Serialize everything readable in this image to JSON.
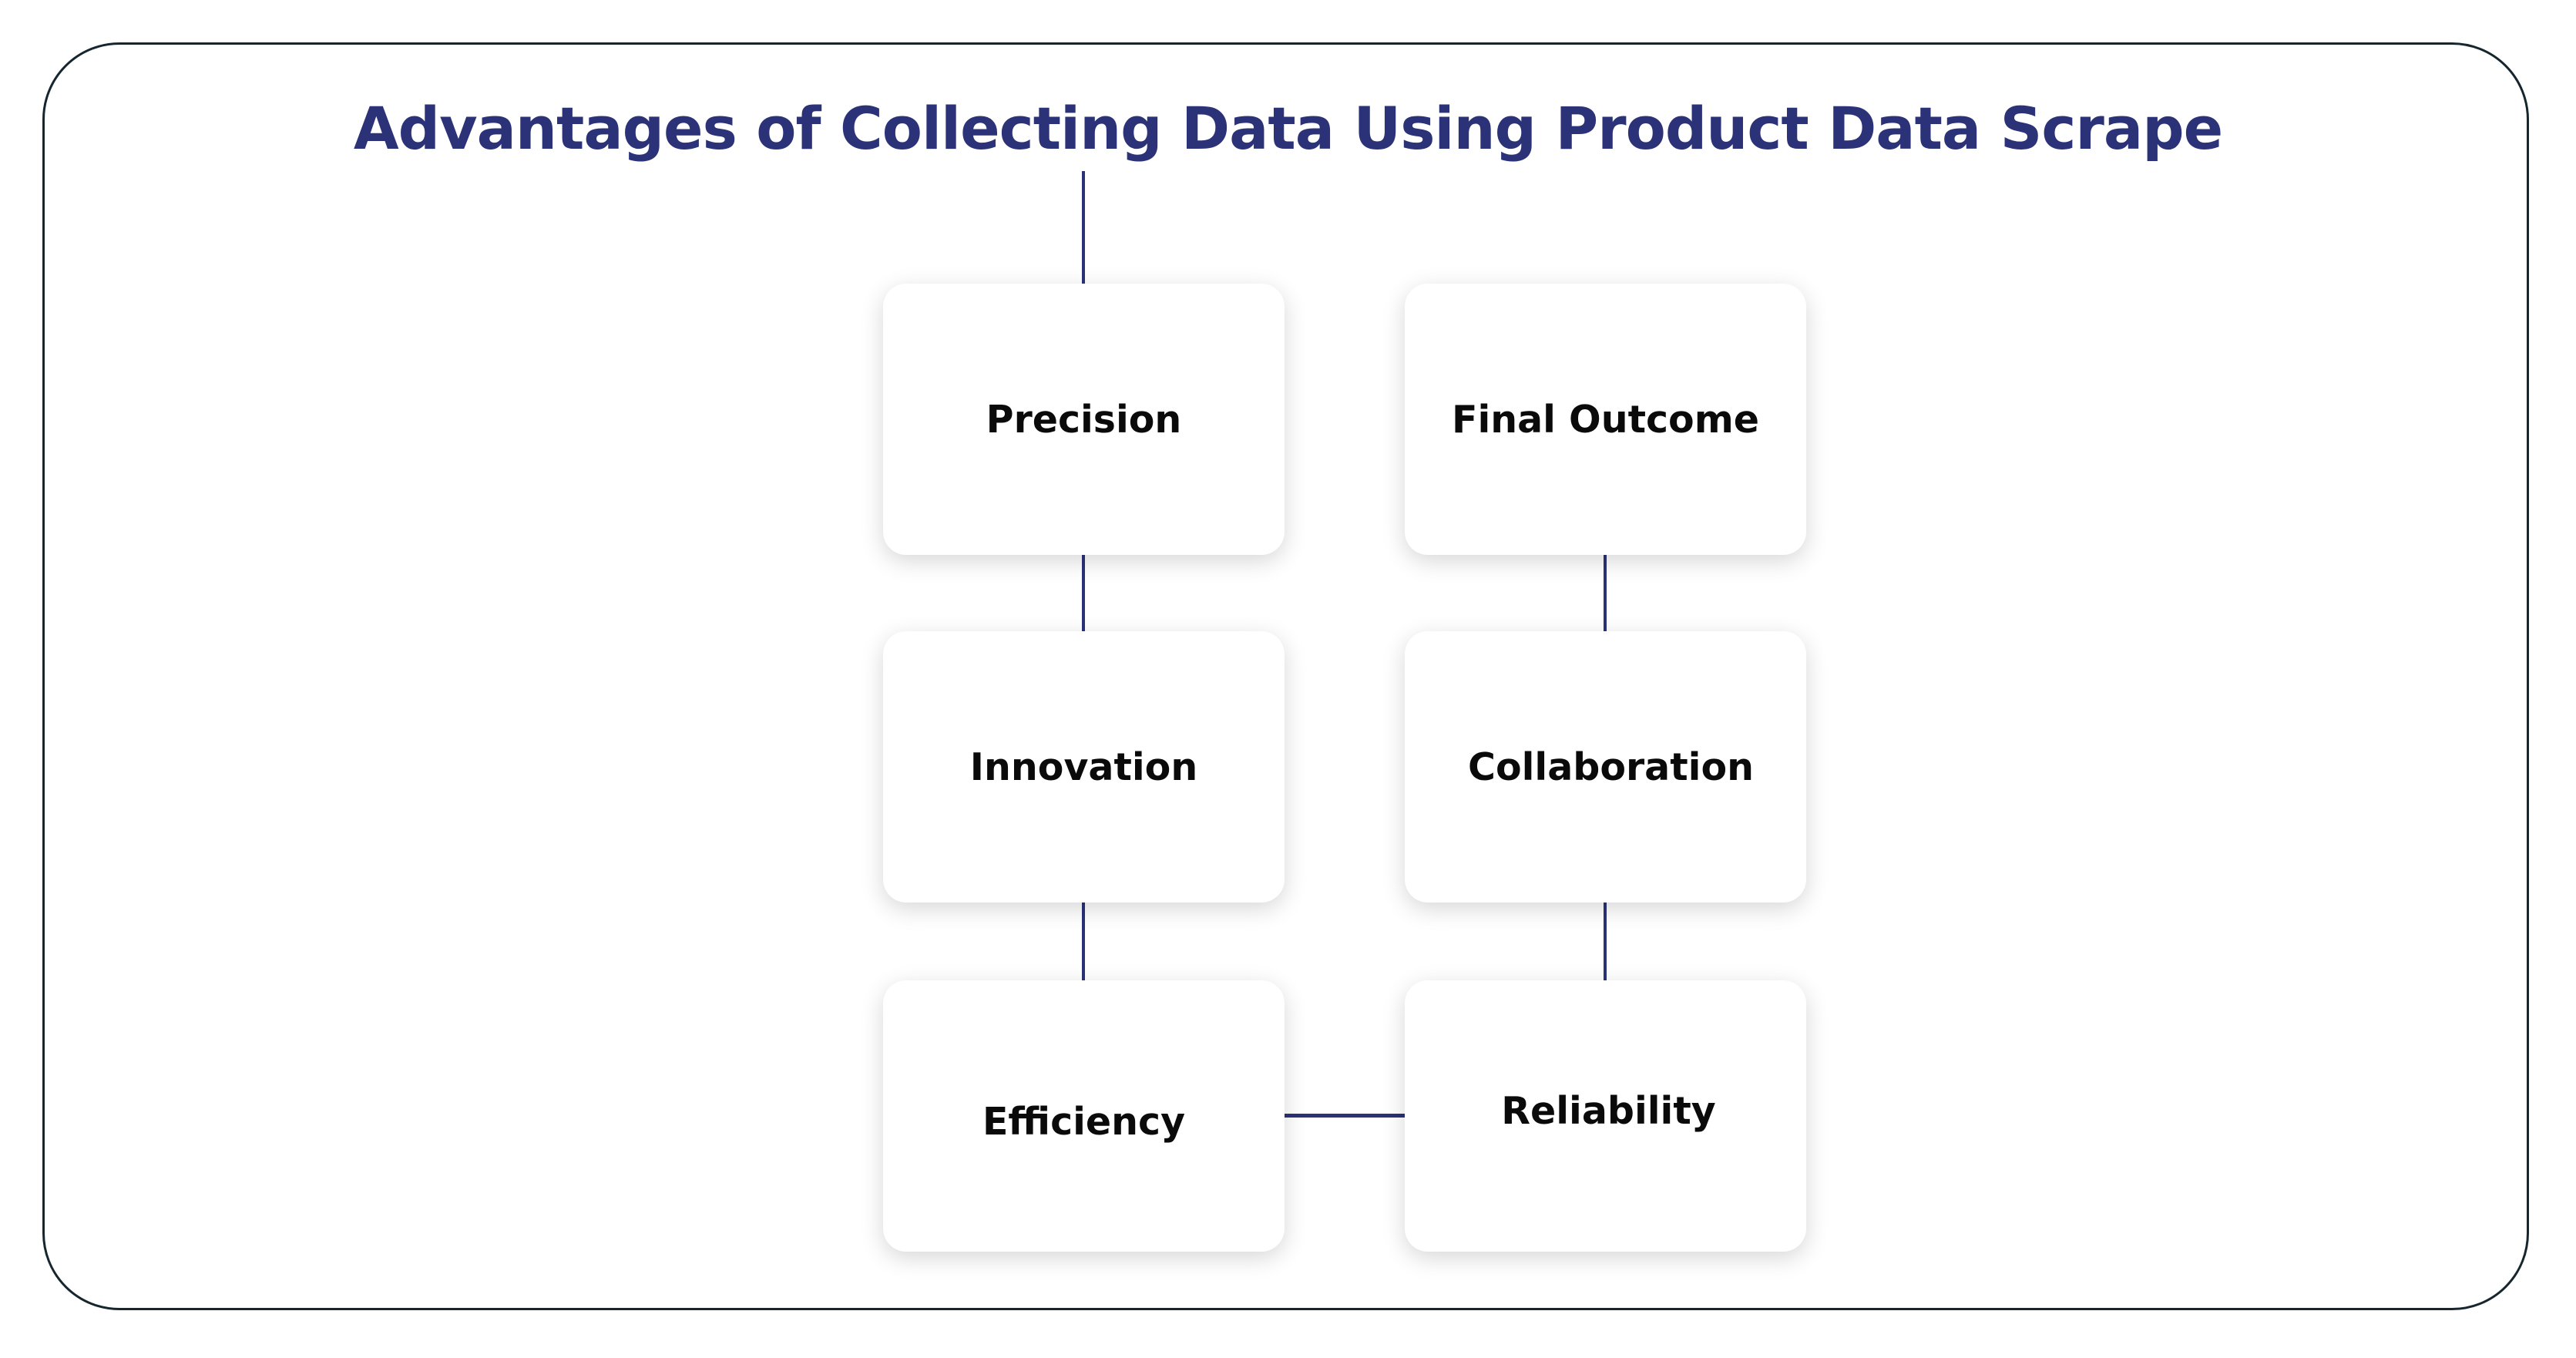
{
  "title": "Advantages of Collecting Data Using Product Data Scrape",
  "colors": {
    "title": "#2b3278",
    "connector": "#2b3278",
    "frame": "#16262e",
    "box_text": "#0a0a0a"
  },
  "nodes": [
    {
      "id": "precision",
      "label": "Precision"
    },
    {
      "id": "innovation",
      "label": "Innovation"
    },
    {
      "id": "efficiency",
      "label": "Efficiency"
    },
    {
      "id": "reliability",
      "label": "Reliability"
    },
    {
      "id": "collaboration",
      "label": "Collaboration"
    },
    {
      "id": "final-outcome",
      "label": "Final Outcome"
    }
  ],
  "edges": [
    [
      "title",
      "precision"
    ],
    [
      "precision",
      "innovation"
    ],
    [
      "innovation",
      "efficiency"
    ],
    [
      "efficiency",
      "reliability"
    ],
    [
      "reliability",
      "collaboration"
    ],
    [
      "collaboration",
      "final-outcome"
    ]
  ]
}
